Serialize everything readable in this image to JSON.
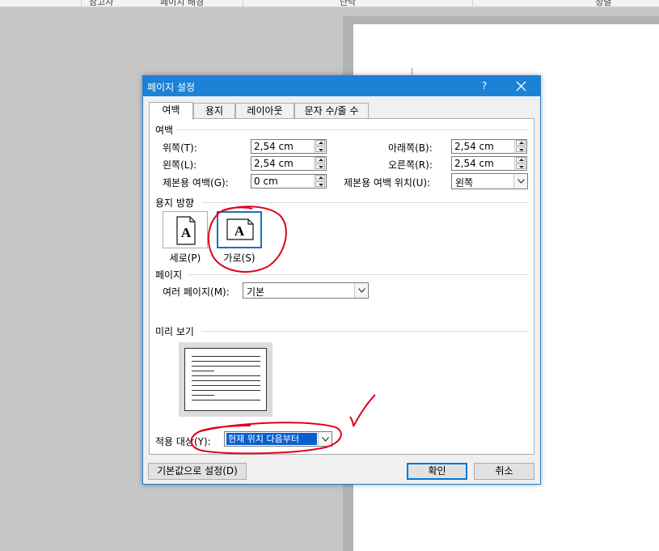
{
  "ribbon": {
    "groups": [
      "참고자",
      "페이지 배경",
      "단락",
      "정렬"
    ]
  },
  "dialog": {
    "title": "페이지 설정",
    "help_label": "?",
    "tabs": [
      {
        "label": "여백",
        "active": true
      },
      {
        "label": "용지",
        "active": false
      },
      {
        "label": "레이아웃",
        "active": false
      },
      {
        "label": "문자 수/줄 수",
        "active": false
      }
    ],
    "margins": {
      "section_title": "여백",
      "top": {
        "label": "위쪽(T):",
        "value": "2,54 cm"
      },
      "bottom": {
        "label": "아래쪽(B):",
        "value": "2,54 cm"
      },
      "left": {
        "label": "왼쪽(L):",
        "value": "2,54 cm"
      },
      "right": {
        "label": "오른쪽(R):",
        "value": "2,54 cm"
      },
      "gutter": {
        "label": "제본용 여백(G):",
        "value": "0 cm"
      },
      "gutter_position": {
        "label": "제본용 여백 위치(U):",
        "value": "왼쪽"
      }
    },
    "orientation": {
      "section_title": "용지 방향",
      "portrait": {
        "label": "세로(P)",
        "glyph": "A"
      },
      "landscape": {
        "label": "가로(S)",
        "glyph": "A",
        "selected": true
      }
    },
    "pages": {
      "section_title": "페이지",
      "multiple_label": "여러 페이지(M):",
      "multiple_value": "기본"
    },
    "preview": {
      "section_title": "미리 보기"
    },
    "apply": {
      "label": "적용 대상(Y):",
      "value": "현재 위치 다음부터"
    },
    "buttons": {
      "set_default": "기본값으로 설정(D)",
      "ok": "확인",
      "cancel": "취소"
    }
  },
  "colors": {
    "titlebar": "#1c82d6",
    "selection": "#0a5fd0",
    "annotation": "#e0001a"
  }
}
